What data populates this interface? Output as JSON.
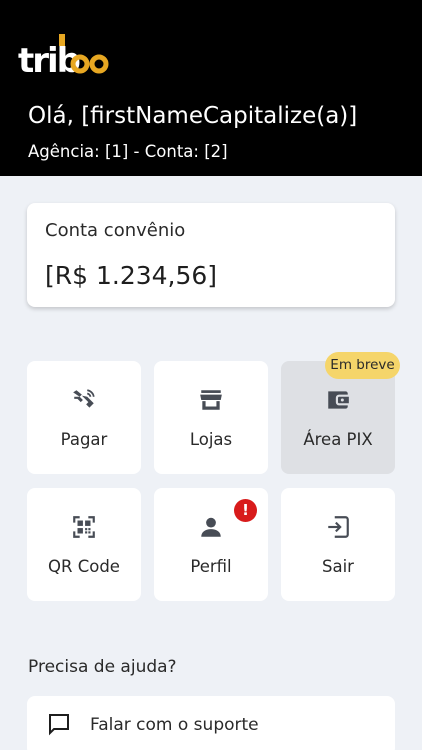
{
  "brand": {
    "logo_text": "trib",
    "accent_color": "#E7A722"
  },
  "header": {
    "greeting": "Olá, [firstNameCapitalize(a)]",
    "account_line": "Agência: [1] - Conta: [2]",
    "background": "#000000"
  },
  "balance": {
    "label": "Conta convênio",
    "value": "[R$ 1.234,56]"
  },
  "tiles": [
    {
      "label": "Pagar",
      "icon": "contactless-pay-icon"
    },
    {
      "label": "Lojas",
      "icon": "storefront-icon"
    },
    {
      "label": "Área PIX",
      "icon": "wallet-icon",
      "disabled": true,
      "badge": "Em breve"
    },
    {
      "label": "QR Code",
      "icon": "qr-code-icon"
    },
    {
      "label": "Perfil",
      "icon": "person-icon",
      "alert": "!"
    },
    {
      "label": "Sair",
      "icon": "logout-icon"
    }
  ],
  "help": {
    "title": "Precisa de ajuda?",
    "support_label": "Falar com o suporte",
    "support_icon": "chat-icon"
  },
  "colors": {
    "page_bg": "#EEF1F6",
    "icon": "#474C55",
    "badge_soon": "#F5D56A",
    "badge_alert": "#D81B1B"
  }
}
